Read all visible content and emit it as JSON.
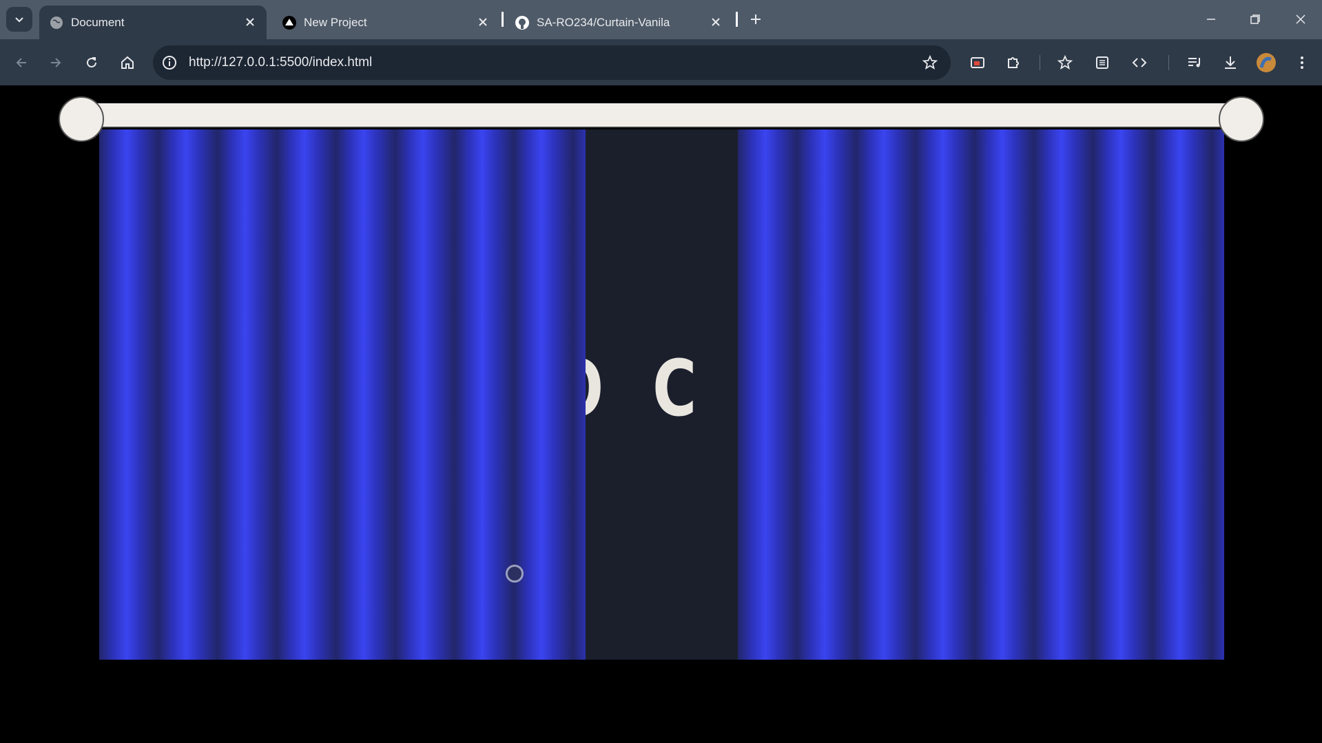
{
  "tabs": [
    {
      "title": "Document",
      "icon": "globe-icon",
      "active": true
    },
    {
      "title": "New Project",
      "icon": "vercel-triangle-icon",
      "active": false
    },
    {
      "title": "SA-RO234/Curtain-Vanila",
      "icon": "github-icon",
      "active": false
    }
  ],
  "toolbar": {
    "url": "http://127.0.0.1:5500/index.html"
  },
  "page": {
    "reveal_text": "TO C",
    "curtain_color": "#3a44f0",
    "rod_color": "#f1eee9",
    "stage_color": "#1b1f2c"
  }
}
